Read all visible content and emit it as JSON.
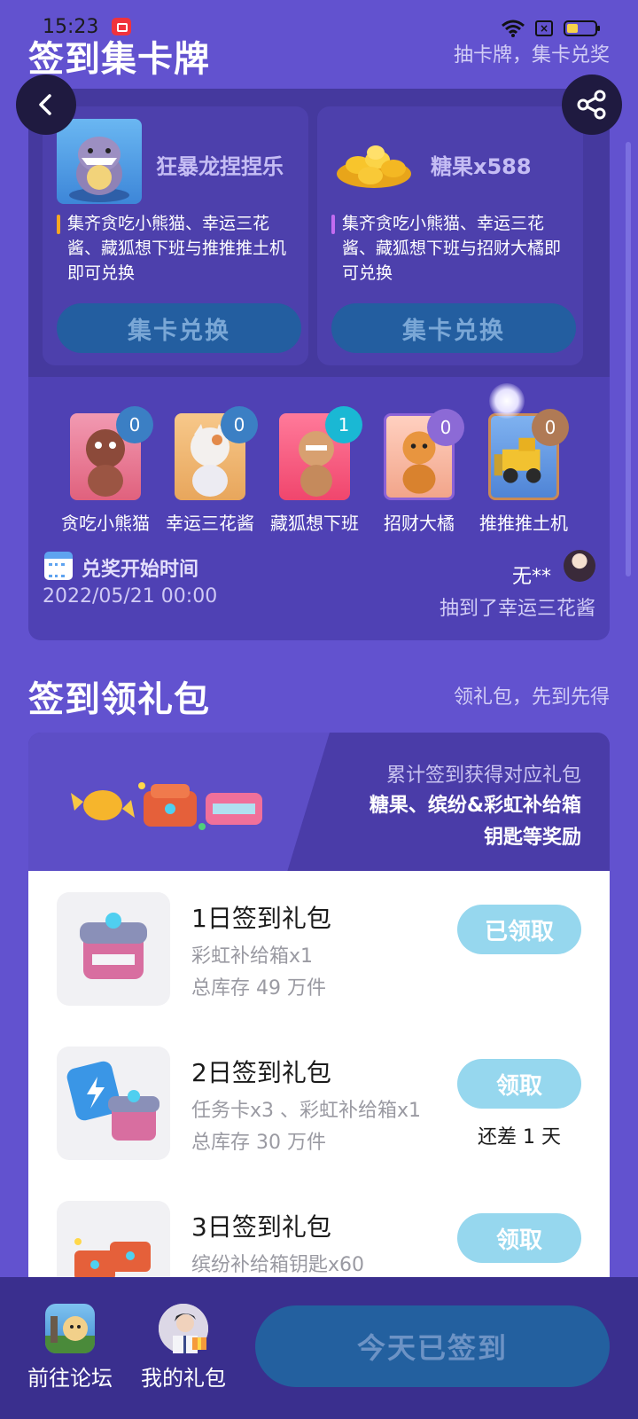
{
  "status_bar": {
    "time": "15:23"
  },
  "collect_section": {
    "title": "签到集卡牌",
    "subtitle": "抽卡牌，集卡兑奖",
    "rewards": [
      {
        "name": "狂暴龙捏捏乐",
        "desc": "集齐贪吃小熊猫、幸运三花酱、藏狐想下班与推推推土机即可兑换",
        "button": "集卡兑换",
        "accent": "#f6a623"
      },
      {
        "name": "糖果x588",
        "desc": "集齐贪吃小熊猫、幸运三花酱、藏狐想下班与招财大橘即可兑换",
        "button": "集卡兑换",
        "accent": "#c36cf0"
      }
    ],
    "cards": [
      {
        "name": "贪吃小熊猫",
        "count": "0",
        "badge_color": "#3b7fc4"
      },
      {
        "name": "幸运三花酱",
        "count": "0",
        "badge_color": "#3b7fc4"
      },
      {
        "name": "藏狐想下班",
        "count": "1",
        "badge_color": "#1ab8d4"
      },
      {
        "name": "招财大橘",
        "count": "0",
        "badge_color": "#8c6ad6"
      },
      {
        "name": "推推推土机",
        "count": "0",
        "badge_color": "#b07a55"
      }
    ],
    "redeem_label": "兑奖开始时间",
    "redeem_time": "2022/05/21 00:00",
    "winner_name": "无**",
    "winner_text": "抽到了幸运三花酱"
  },
  "gift_section": {
    "title": "签到领礼包",
    "subtitle": "领礼包，先到先得",
    "banner_line1": "累计签到获得对应礼包",
    "banner_line2": "糖果、缤纷&彩虹补给箱",
    "banner_line3": "钥匙等奖励",
    "gifts": [
      {
        "title": "1日签到礼包",
        "items": "彩虹补给箱x1",
        "stock": "总库存 49 万件",
        "button": "已领取",
        "note": ""
      },
      {
        "title": "2日签到礼包",
        "items": "任务卡x3 、彩虹补给箱x1",
        "stock": "总库存 30 万件",
        "button": "领取",
        "note": "还差 1 天"
      },
      {
        "title": "3日签到礼包",
        "items": "缤纷补给箱钥匙x60",
        "stock": "",
        "button": "领取",
        "note": ""
      }
    ]
  },
  "bottom_bar": {
    "forum_label": "前往论坛",
    "gifts_label": "我的礼包",
    "checkin_label": "今天已签到"
  }
}
